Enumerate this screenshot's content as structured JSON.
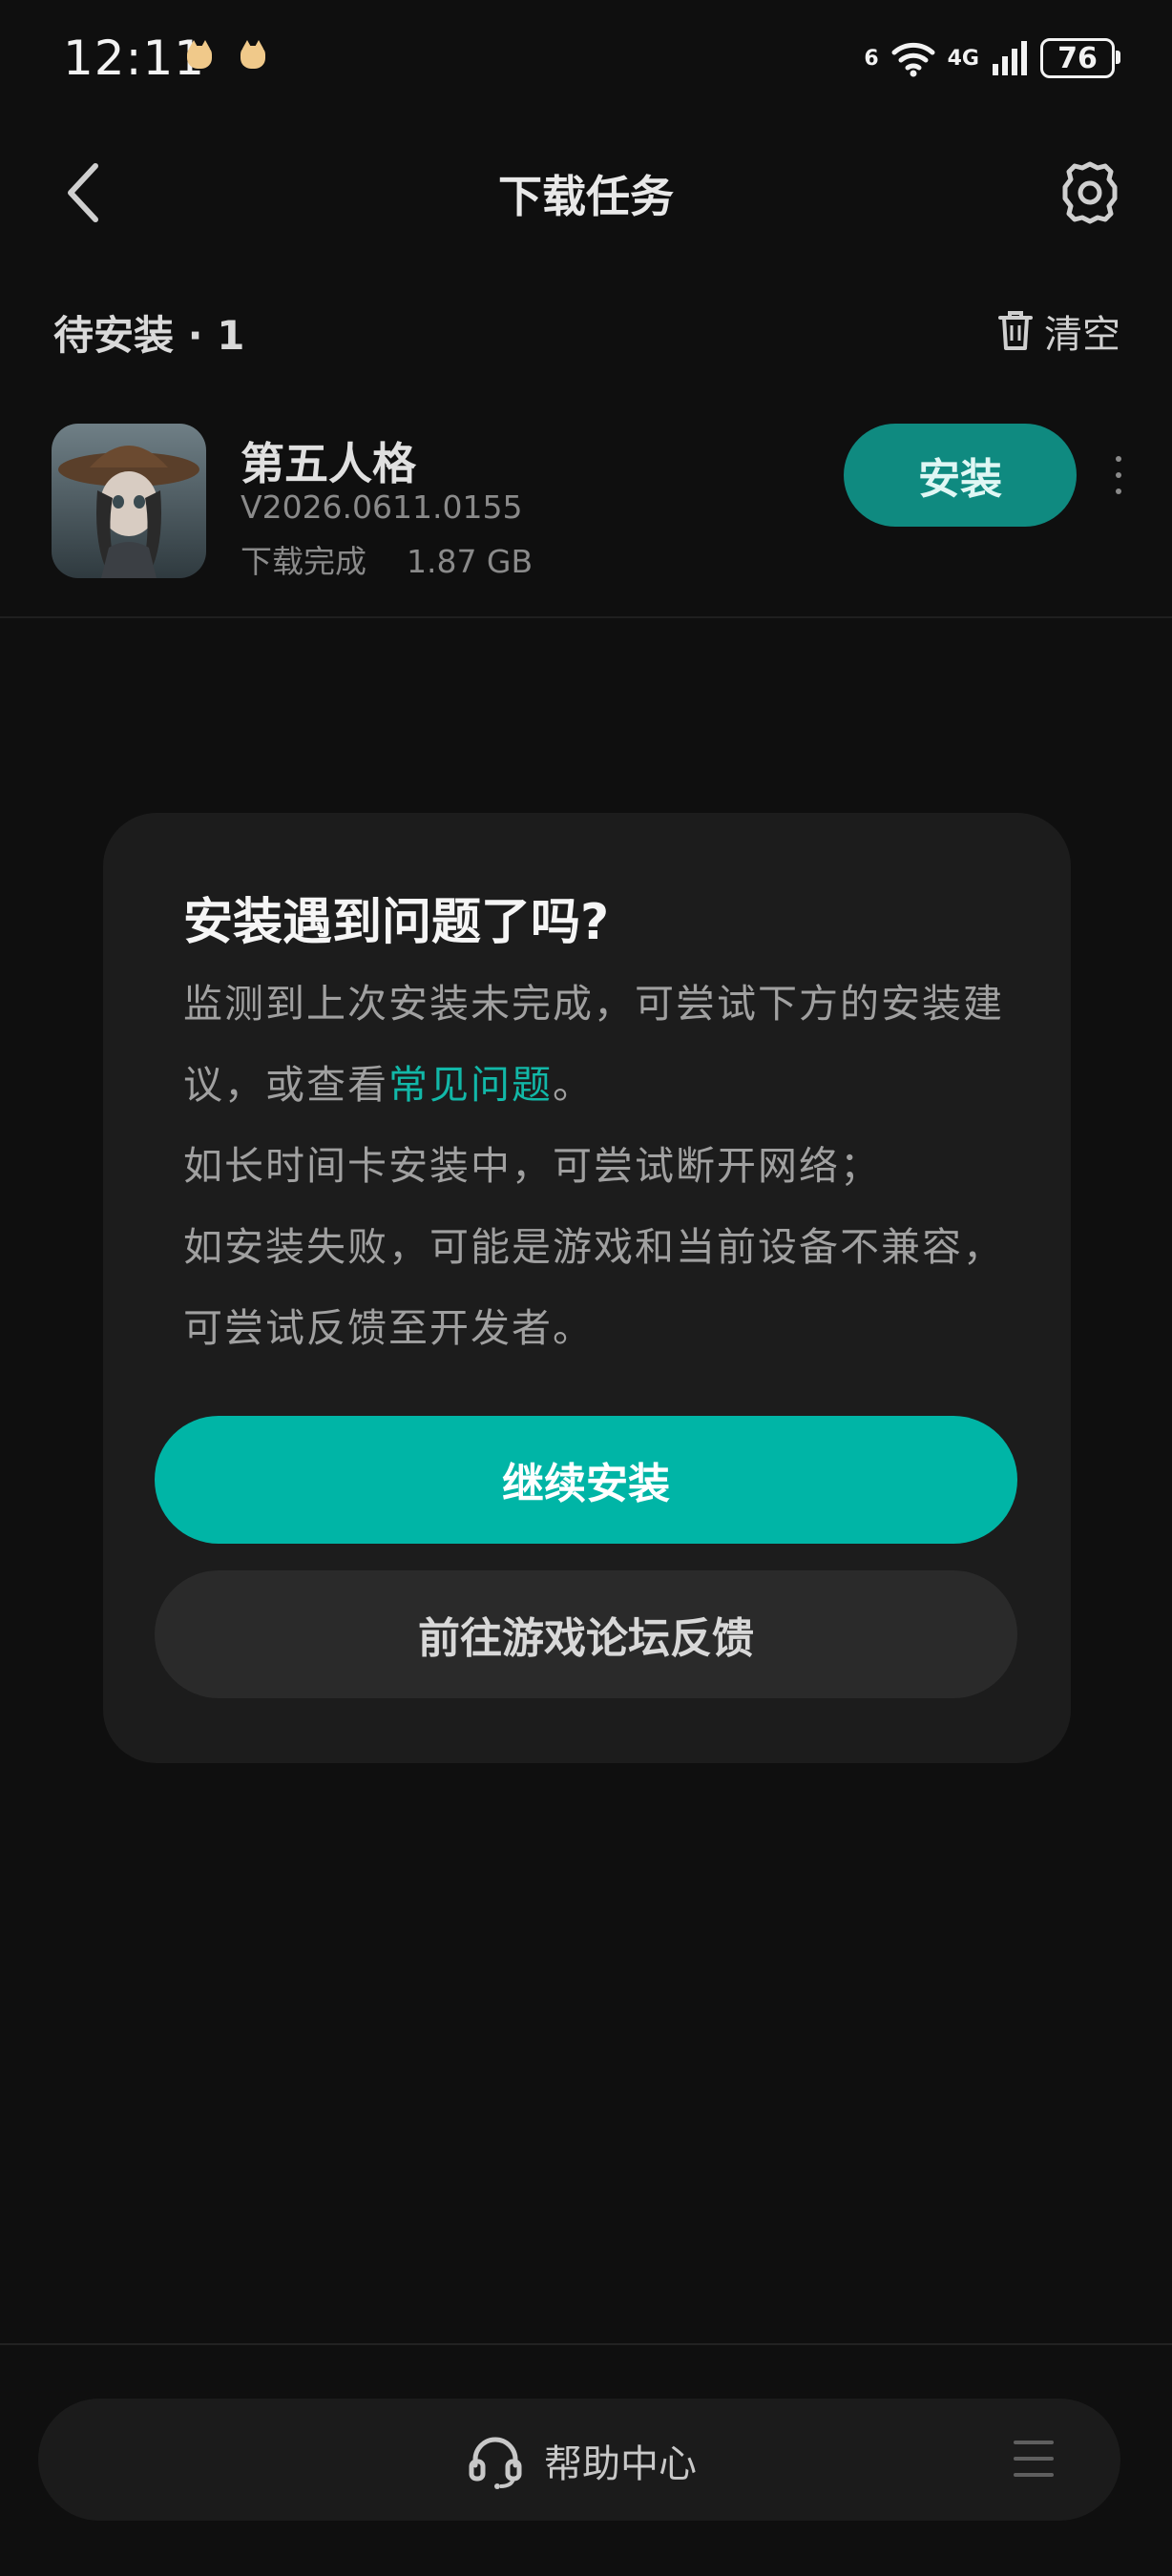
{
  "status_bar": {
    "time": "12:11",
    "wifi_label": "6",
    "network_label": "4G",
    "battery": "76",
    "notification_icons": [
      "cat-face-icon",
      "cat-face-icon"
    ]
  },
  "header": {
    "title": "下载任务",
    "back_icon": "chevron-left-icon",
    "settings_icon": "gear-icon"
  },
  "section": {
    "title": "待安装 · 1",
    "clear_label": "清空",
    "clear_icon": "trash-icon"
  },
  "app": {
    "name": "第五人格",
    "version": "V2026.0611.0155",
    "status": "下载完成    1.87 GB",
    "install_label": "安装"
  },
  "dialog": {
    "title": "安装遇到问题了吗?",
    "body_line1_pre": "监测到上次安装未完成，可尝试下方的安装建议，或查看",
    "body_link": "常见问题",
    "body_line1_post": "。",
    "body_line2": "如长时间卡安装中，可尝试断开网络；",
    "body_line3": "如安装失败，可能是游戏和当前设备不兼容，可尝试反馈至开发者。",
    "primary_label": "继续安装",
    "secondary_label": "前往游戏论坛反馈"
  },
  "bottom": {
    "help_label": "帮助中心",
    "help_icon": "headset-icon",
    "menu_icon": "menu-icon"
  },
  "colors": {
    "background": "#0f0f0f",
    "accent": "#00b5a6",
    "install_button": "#0f8a80",
    "dialog": "#1c1c1c"
  }
}
